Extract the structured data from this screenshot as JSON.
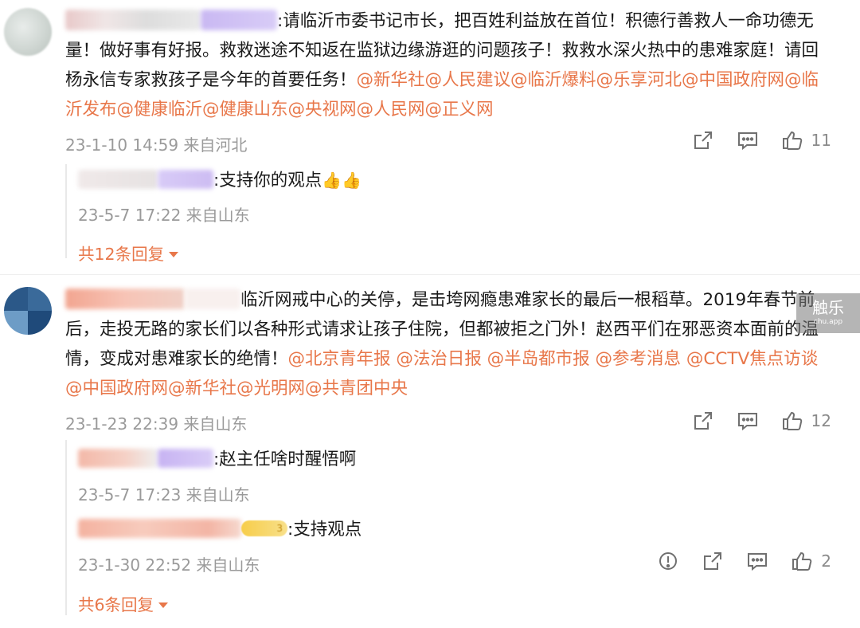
{
  "comments": [
    {
      "name_fragment": "征 群 · · 子的 · · · llhu···泠··",
      "body": ":请临沂市委书记市长，把百姓利益放在首位！积德行善救人一命功德无量！做好事有好报。救救迷途不知返在监狱边缘游逛的问题孩子！救救水深火热中的患难家庭！请回杨永信专家救孩子是今年的首要任务！",
      "mentions": "@新华社@人民建议@临沂爆料@乐享河北@中国政府网@临沂发布@健康临沂@健康山东@央视网@人民网@正义网",
      "meta": "23-1-10 14:59 来自河北",
      "likes": "11",
      "replies": [
        {
          "name_fragment": "·彩霞 · · 贝· ·",
          "text": ":支持你的观点",
          "emoji": "👍👍",
          "meta": "23-5-7 17:22 来自山东"
        }
      ],
      "more_replies": "共12条回复"
    },
    {
      "name_fragment": "·智 · 惠机器·",
      "body": "临沂网戒中心的关停，是击垮网瘾患难家长的最后一根稻草。2019年春节前后，走投无路的家长们以各种形式请求让孩子住院，但都被拒之门外！赵西平们在邪恶资本面前的温情，变成对患难家长的绝情！",
      "mentions": "@北京青年报 @法治日报 @半岛都市报 @参考消息 @CCTV焦点访谈 @中国政府网@新华社@光明网@共青团中央",
      "meta": "23-1-23 22:39 来自山东",
      "likes": "12",
      "replies": [
        {
          "name_fragment": "1彩霞 · 舞· ·",
          "text": ":赵主任啥时醒悟啊",
          "meta": "23-5-7 17:23 来自山东"
        },
        {
          "name_fragment": "·光· · 水木369_ · 8",
          "badge": "3",
          "text": ":支持观点",
          "meta": "23-1-30 22:52 来自山东",
          "likes": "2"
        }
      ],
      "more_replies": "共6条回复"
    }
  ],
  "watermark": {
    "title": "触乐",
    "sub": "chu.app"
  },
  "icons": [
    "share-icon",
    "comment-icon",
    "like-icon",
    "report-icon"
  ],
  "colors": {
    "mention": "#e8774a",
    "meta": "#9a9a9a",
    "icon": "#707070"
  }
}
